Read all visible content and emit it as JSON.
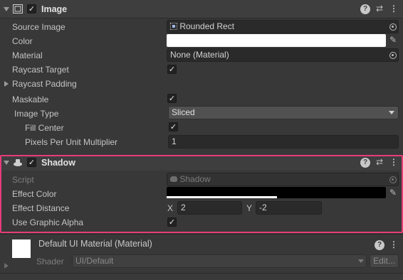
{
  "image_component": {
    "title": "Image",
    "source_image_label": "Source Image",
    "source_image_value": "Rounded Rect",
    "color_label": "Color",
    "color_value": "#ffffff",
    "material_label": "Material",
    "material_value": "None (Material)",
    "raycast_target_label": "Raycast Target",
    "raycast_target_checked": true,
    "raycast_padding_label": "Raycast Padding",
    "maskable_label": "Maskable",
    "maskable_checked": true,
    "image_type_label": "Image Type",
    "image_type_value": "Sliced",
    "fill_center_label": "Fill Center",
    "fill_center_checked": true,
    "ppu_label": "Pixels Per Unit Multiplier",
    "ppu_value": "1"
  },
  "shadow_component": {
    "title": "Shadow",
    "script_label": "Script",
    "script_value": "Shadow",
    "effect_color_label": "Effect Color",
    "effect_color_value": "#000000",
    "effect_distance_label": "Effect Distance",
    "x_label": "X",
    "x_value": "2",
    "y_label": "Y",
    "y_value": "-2",
    "use_graphic_alpha_label": "Use Graphic Alpha",
    "use_graphic_alpha_checked": true,
    "highlight_color": "#e63c7a"
  },
  "material_section": {
    "title": "Default UI Material (Material)",
    "shader_label": "Shader",
    "shader_value": "UI/Default",
    "edit_label": "Edit..."
  },
  "icons": {
    "help": "?",
    "presets": "⇄",
    "more": "⋮",
    "checkmark": "✓",
    "eyedropper": "✎"
  }
}
